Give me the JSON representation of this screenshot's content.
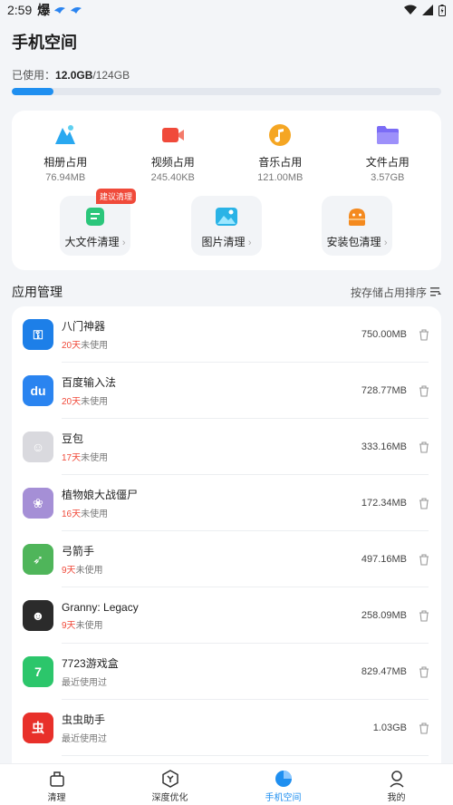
{
  "status": {
    "time": "2:59",
    "app_glyph": "爆"
  },
  "header": {
    "title": "手机空间"
  },
  "usage": {
    "label": "已使用：",
    "used": "12.0GB",
    "total": "/124GB",
    "fraction": 0.097
  },
  "categories": [
    {
      "name": "相册占用",
      "size": "76.94MB",
      "icon": "photos-icon",
      "color": "#29a8f0"
    },
    {
      "name": "视频占用",
      "size": "245.40KB",
      "icon": "video-icon",
      "color": "#f04a3a"
    },
    {
      "name": "音乐占用",
      "size": "121.00MB",
      "icon": "music-icon",
      "color": "#f5a623"
    },
    {
      "name": "文件占用",
      "size": "3.57GB",
      "icon": "folder-icon",
      "color": "#7b6cf6"
    }
  ],
  "tools": [
    {
      "label": "大文件清理",
      "badge": "建议清理",
      "icon": "file-icon",
      "color": "#2bc67b"
    },
    {
      "label": "图片清理",
      "icon": "image-icon",
      "color": "#2ab3e6"
    },
    {
      "label": "安装包清理",
      "icon": "android-icon",
      "color": "#f48a1f"
    }
  ],
  "apps_section": {
    "title": "应用管理",
    "sort_label": "按存储占用排序"
  },
  "apps": [
    {
      "name": "八门神器",
      "days": "20天",
      "suffix": "未使用",
      "size": "750.00MB",
      "color": "#1d7fe8",
      "glyph": "⚿"
    },
    {
      "name": "百度输入法",
      "days": "20天",
      "suffix": "未使用",
      "size": "728.77MB",
      "color": "#2a84f0",
      "glyph": "du"
    },
    {
      "name": "豆包",
      "days": "17天",
      "suffix": "未使用",
      "size": "333.16MB",
      "color": "#d9d9de",
      "glyph": "☺"
    },
    {
      "name": "植物娘大战僵尸",
      "days": "16天",
      "suffix": "未使用",
      "size": "172.34MB",
      "color": "#a58fd6",
      "glyph": "❀"
    },
    {
      "name": "弓箭手",
      "days": "9天",
      "suffix": "未使用",
      "size": "497.16MB",
      "color": "#4fb55a",
      "glyph": "➶"
    },
    {
      "name": "Granny: Legacy",
      "days": "9天",
      "suffix": "未使用",
      "size": "258.09MB",
      "color": "#2b2b2b",
      "glyph": "☻"
    },
    {
      "name": "7723游戏盒",
      "days": "",
      "suffix": "最近使用过",
      "size": "829.47MB",
      "color": "#2cc66b",
      "glyph": "7"
    },
    {
      "name": "虫虫助手",
      "days": "",
      "suffix": "最近使用过",
      "size": "1.03GB",
      "color": "#e8302a",
      "glyph": "虫"
    }
  ],
  "nav": [
    {
      "label": "清理",
      "icon": "clean-icon"
    },
    {
      "label": "深度优化",
      "icon": "optimize-icon"
    },
    {
      "label": "手机空间",
      "icon": "storage-icon",
      "active": true
    },
    {
      "label": "我的",
      "icon": "profile-icon"
    }
  ]
}
